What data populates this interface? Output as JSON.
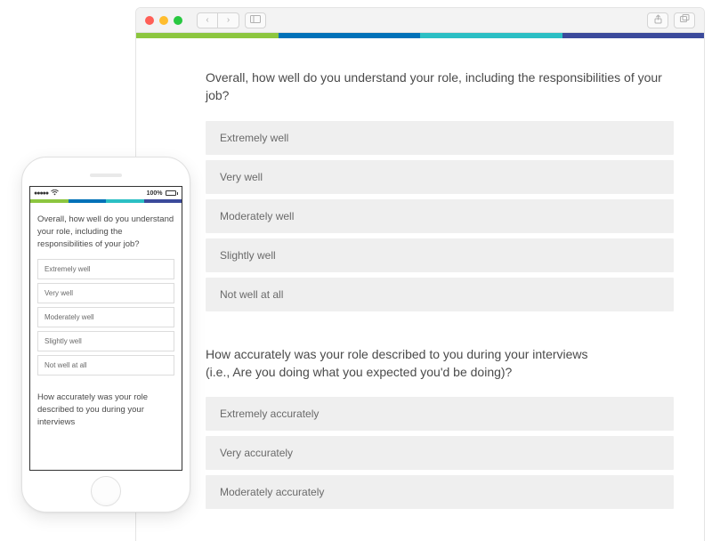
{
  "stripe_colors": [
    "#8cc63f",
    "#0071b8",
    "#2bbfc4",
    "#3b4a9b"
  ],
  "browser": {
    "q1": {
      "text": "Overall, how well do you understand your role, including the responsibilities of your job?",
      "options": [
        "Extremely well",
        "Very well",
        "Moderately well",
        "Slightly well",
        "Not well at all"
      ]
    },
    "q2": {
      "line1": "How accurately was your role described to you during your interviews",
      "line2": "(i.e., Are you doing what you expected you'd be doing)?",
      "options": [
        "Extremely accurately",
        "Very accurately",
        "Moderately accurately"
      ]
    }
  },
  "phone": {
    "status": {
      "signal": "●●●●●",
      "battery_pct": "100%"
    },
    "q1": {
      "text": "Overall, how well do you understand your role, including the responsibilities of your job?",
      "options": [
        "Extremely well",
        "Very well",
        "Moderately well",
        "Slightly well",
        "Not well at all"
      ]
    },
    "q2": {
      "text": "How accurately was your role described to you during your interviews"
    }
  }
}
